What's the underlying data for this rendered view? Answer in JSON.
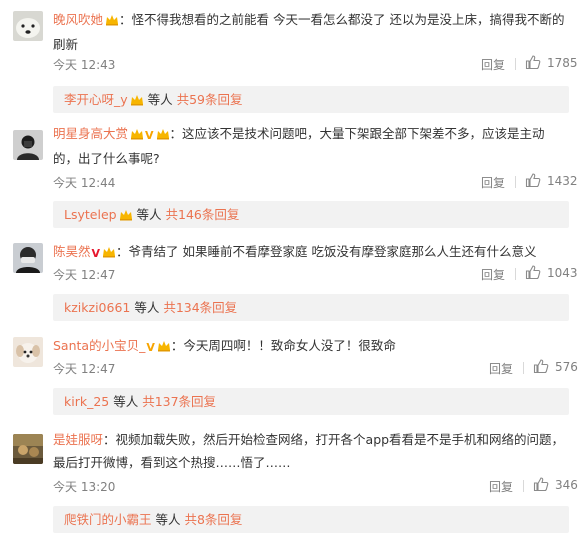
{
  "comments": [
    {
      "username": "晚风吹她",
      "separator": "：",
      "text": "怪不得我想看的之前能看 今天一看怎么都没了 还以为是没上床，搞得我不断的刷新",
      "time": "今天 12:43",
      "reply_label": "回复",
      "likes": "1785",
      "sub_user": "李开心呀_y",
      "sub_mid": " 等人 ",
      "sub_total": "共59条回复",
      "badge": "crown",
      "avatar_icon": "polar-bear-avatar"
    },
    {
      "username": "明星身高大赏",
      "separator": "：",
      "text": "这应该不是技术问题吧，大量下架跟全部下架差不多，应该是主动的，出了什么事呢?",
      "time": "今天 12:44",
      "reply_label": "回复",
      "likes": "1432",
      "sub_user": "Lsytelep",
      "sub_mid": " 等人 ",
      "sub_total": "共146条回复",
      "badge": "vip",
      "vmark": "V",
      "avatar_icon": "dark-portrait-avatar"
    },
    {
      "username": "陈昊然",
      "separator": "：",
      "text": "爷青结了 如果睡前不看摩登家庭 吃饭没有摩登家庭那么人生还有什么意义",
      "time": "今天 12:47",
      "reply_label": "回复",
      "likes": "1043",
      "sub_user": "kzikzi0661",
      "sub_mid": " 等人 ",
      "sub_total": "共134条回复",
      "badge": "crown",
      "vmark": "V",
      "avatar_icon": "masked-person-avatar"
    },
    {
      "username": "Santa的小宝贝_",
      "separator": "：",
      "text": "今天周四啊！！致命女人没了！很致命",
      "time": "今天 12:47",
      "reply_label": "回复",
      "likes": "576",
      "sub_user": "kirk_25",
      "sub_mid": " 等人 ",
      "sub_total": "共137条回复",
      "badge": "crown",
      "vmark": "V",
      "avatar_icon": "puppy-avatar"
    },
    {
      "username": "是娃服呀",
      "separator": "：",
      "text": "视频加载失败，然后开始检查网络，打开各个app看看是不是手机和网络的问题，最后打开微博，看到这个热搜……悟了……",
      "time": "今天 13:20",
      "reply_label": "回复",
      "likes": "346",
      "sub_user": "爬铁门的小霸王",
      "sub_mid": " 等人 ",
      "sub_total": "共8条回复",
      "badge": "none",
      "avatar_icon": "painting-avatar"
    }
  ],
  "colors": {
    "username": "#eb7350",
    "meta": "#808080",
    "sub_bg": "#f2f2f2",
    "vip_gold": "#f7a400",
    "vip_red": "#e6162d"
  }
}
